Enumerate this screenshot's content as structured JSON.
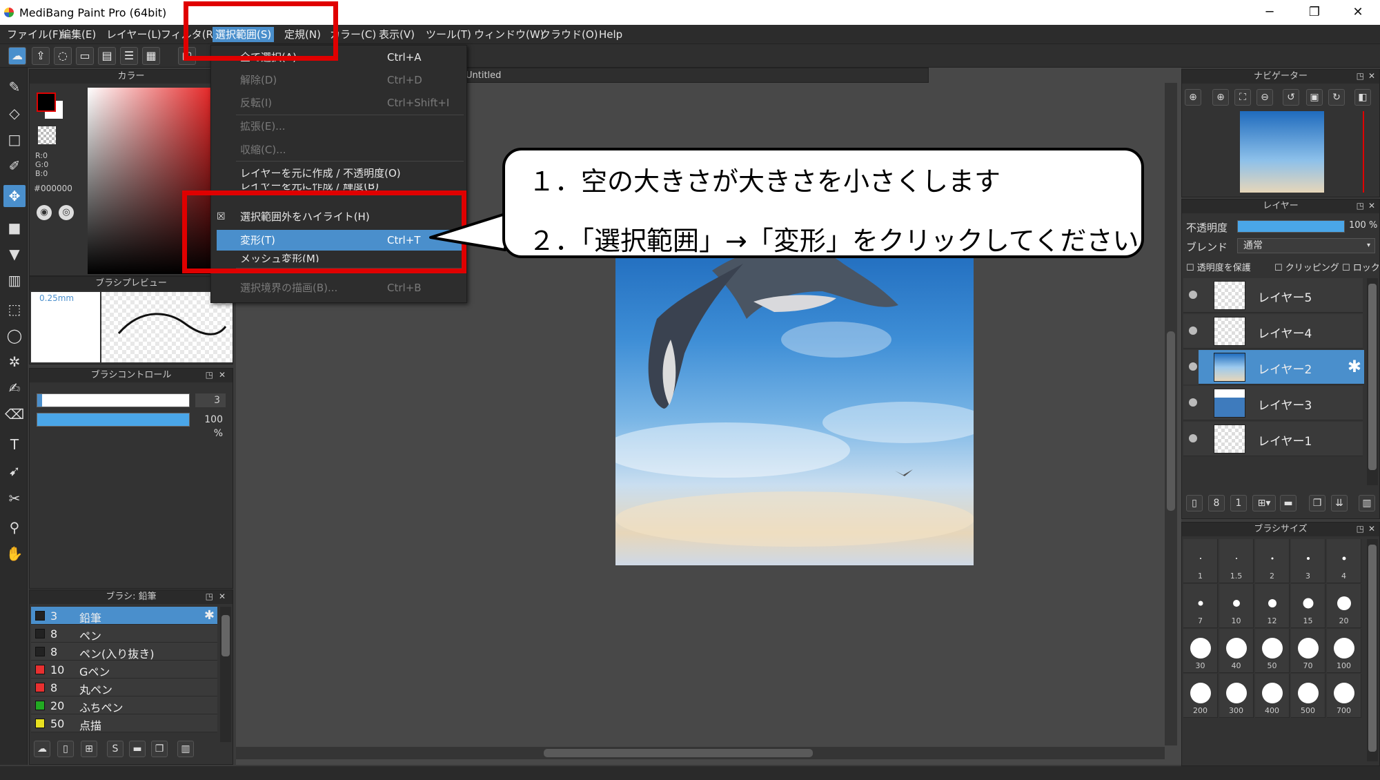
{
  "window": {
    "title": "MediBang Paint Pro (64bit)",
    "minimize": "─",
    "restore": "❐",
    "close": "✕"
  },
  "menubar": [
    "ファイル(F)",
    "編集(E)",
    "レイヤー(L)",
    "フィルタ(R)",
    "選択範囲(S)",
    "定規(N)",
    "カラー(C)",
    "表示(V)",
    "ツール(T)",
    "ウィンドウ(W)",
    "クラウド(O)",
    "Help"
  ],
  "tab": {
    "title": "Untitled"
  },
  "color_panel": {
    "title": "カラー",
    "r": "R:0",
    "g": "G:0",
    "b": "B:0",
    "hex": "#000000",
    "primary": "#000000",
    "secondary": "#ffffff"
  },
  "brush_preview": {
    "title": "ブラシプレビュー",
    "size": "0.25mm"
  },
  "brush_control": {
    "title": "ブラシコントロール",
    "size_value": "3",
    "opacity_value": "100 %"
  },
  "brush_list": {
    "title": "ブラシ: 鉛筆",
    "items": [
      {
        "num": "3",
        "name": "鉛筆",
        "color": "#222222"
      },
      {
        "num": "8",
        "name": "ペン",
        "color": "#222222"
      },
      {
        "num": "8",
        "name": "ペン(入り抜き)",
        "color": "#222222"
      },
      {
        "num": "10",
        "name": "Gペン",
        "color": "#e83030"
      },
      {
        "num": "8",
        "name": "丸ペン",
        "color": "#e83030"
      },
      {
        "num": "20",
        "name": "ふちペン",
        "color": "#22aa22"
      },
      {
        "num": "50",
        "name": "点描",
        "color": "#e8e020"
      }
    ]
  },
  "dropdown": {
    "items": [
      {
        "label": "全て選択(A)",
        "shortcut": "Ctrl+A",
        "state": "en"
      },
      {
        "label": "解除(D)",
        "shortcut": "Ctrl+D",
        "state": "dis"
      },
      {
        "label": "反転(I)",
        "shortcut": "Ctrl+Shift+I",
        "state": "dis"
      },
      {
        "label": "拡張(E)...",
        "shortcut": "",
        "state": "dis"
      },
      {
        "label": "収縮(C)...",
        "shortcut": "",
        "state": "dis"
      },
      {
        "label": "レイヤーを元に作成 / 不透明度(O)",
        "shortcut": "",
        "state": "en"
      },
      {
        "label": "レイヤーを元に作成 / 輝度(B)",
        "shortcut": "",
        "state": "en"
      },
      {
        "label": "選択範囲外をハイライト(H)",
        "shortcut": "",
        "state": "en"
      },
      {
        "label": "変形(T)",
        "shortcut": "Ctrl+T",
        "state": "hl"
      },
      {
        "label": "メッシュ変形(M)",
        "shortcut": "",
        "state": "en"
      },
      {
        "label": "選択境界の描画(B)...",
        "shortcut": "Ctrl+B",
        "state": "dis"
      }
    ],
    "check_mark": "☒"
  },
  "callout": {
    "line1": "１．空の大きさが大きさを小さくします",
    "line2": "２．「選択範囲」→「変形」をクリックしてください"
  },
  "navigator": {
    "title": "ナビゲーター"
  },
  "layers": {
    "title": "レイヤー",
    "opacity_label": "不透明度",
    "opacity_value": "100 %",
    "opacity": 1.0,
    "blend_label": "ブレンド",
    "blend_value": "通常",
    "protect": "透明度を保護",
    "clipping": "クリッピング",
    "lock": "ロック",
    "items": [
      {
        "name": "レイヤー5"
      },
      {
        "name": "レイヤー4"
      },
      {
        "name": "レイヤー2"
      },
      {
        "name": "レイヤー3"
      },
      {
        "name": "レイヤー1"
      }
    ],
    "gear": "✱"
  },
  "brush_size": {
    "title": "ブラシサイズ",
    "values": [
      "1",
      "1.5",
      "2",
      "3",
      "4",
      "7",
      "10",
      "12",
      "15",
      "20",
      "30",
      "40",
      "50",
      "70",
      "100",
      "200",
      "300",
      "400",
      "500",
      "700"
    ]
  },
  "panel_ctl": {
    "float": "◳",
    "close": "✕"
  }
}
